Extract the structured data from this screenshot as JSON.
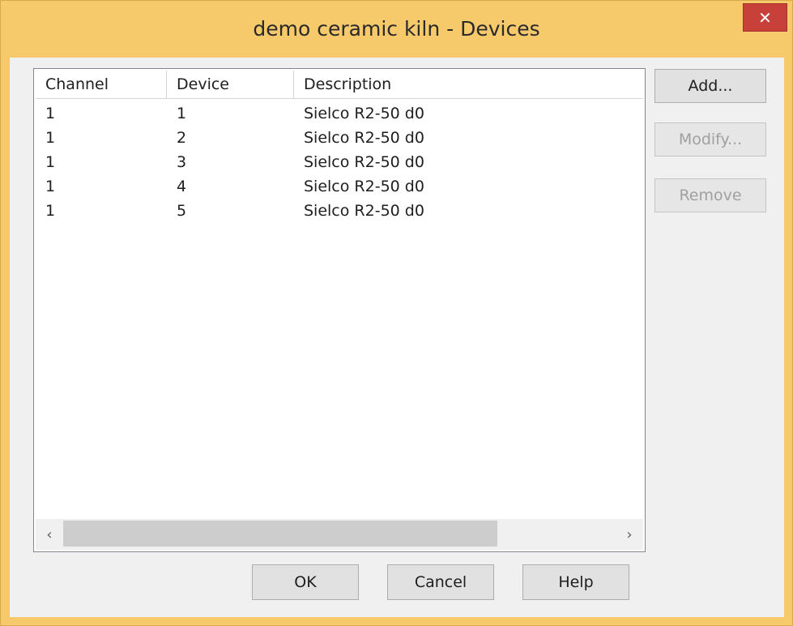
{
  "window": {
    "title": "demo ceramic kiln - Devices",
    "close_glyph": "✕"
  },
  "list": {
    "columns": [
      "Channel",
      "Device",
      "Description"
    ],
    "rows": [
      {
        "channel": "1",
        "device": "1",
        "description": "Sielco R2-50 d0"
      },
      {
        "channel": "1",
        "device": "2",
        "description": "Sielco R2-50 d0"
      },
      {
        "channel": "1",
        "device": "3",
        "description": "Sielco R2-50 d0"
      },
      {
        "channel": "1",
        "device": "4",
        "description": "Sielco R2-50 d0"
      },
      {
        "channel": "1",
        "device": "5",
        "description": "Sielco R2-50 d0"
      }
    ],
    "scroll_left_glyph": "‹",
    "scroll_right_glyph": "›"
  },
  "buttons": {
    "add": "Add...",
    "modify": "Modify...",
    "remove": "Remove",
    "ok": "OK",
    "cancel": "Cancel",
    "help": "Help"
  },
  "colors": {
    "frame": "#f6c96b",
    "close": "#c7403a",
    "dialog": "#f0f0f0"
  }
}
